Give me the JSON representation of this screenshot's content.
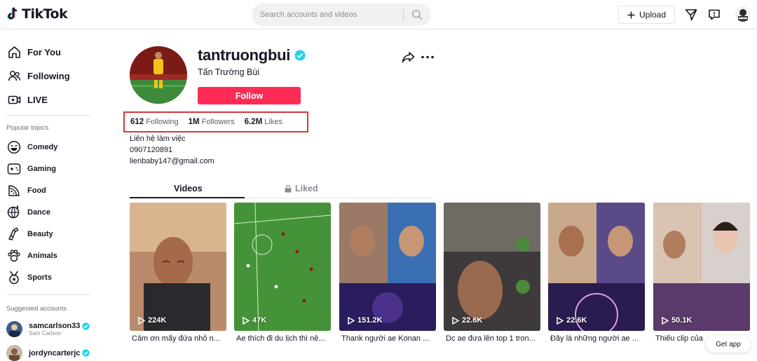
{
  "header": {
    "logo_text": "TikTok",
    "search_placeholder": "Search accounts and videos",
    "upload_label": "Upload",
    "icons": [
      "tiktok-logo-icon",
      "search-icon",
      "plus-icon",
      "send-icon",
      "inbox-icon",
      "avatar"
    ]
  },
  "sidebar": {
    "nav": [
      {
        "label": "For You",
        "icon": "home-icon"
      },
      {
        "label": "Following",
        "icon": "following-icon"
      },
      {
        "label": "LIVE",
        "icon": "live-icon"
      }
    ],
    "popular_title": "Popular topics",
    "topics": [
      {
        "label": "Comedy",
        "icon": "comedy-icon"
      },
      {
        "label": "Gaming",
        "icon": "gaming-icon"
      },
      {
        "label": "Food",
        "icon": "food-icon"
      },
      {
        "label": "Dance",
        "icon": "dance-icon"
      },
      {
        "label": "Beauty",
        "icon": "beauty-icon"
      },
      {
        "label": "Animals",
        "icon": "animals-icon"
      },
      {
        "label": "Sports",
        "icon": "sports-icon"
      }
    ],
    "suggested_title": "Suggested accounts",
    "suggested": [
      {
        "username": "samcarlson33",
        "name": "Sam Carlson"
      },
      {
        "username": "jordyncarterjc",
        "name": ""
      }
    ]
  },
  "profile": {
    "username": "tantruongbui",
    "display_name": "Tấn Trường Bùi",
    "follow_label": "Follow",
    "following_count": "612",
    "following_label": "Following",
    "followers_count": "1M",
    "followers_label": "Followers",
    "likes_count": "6.2M",
    "likes_label": "Likes",
    "bio": [
      "Liên hệ làm việc",
      "0907120891",
      "lienbaby147@gmail.com"
    ]
  },
  "tabs": {
    "videos": "Videos",
    "liked": "Liked"
  },
  "videos": [
    {
      "views": "224K",
      "caption": "Cảm ơn mấy đứa nhỏ n..."
    },
    {
      "views": "47K",
      "caption": "Ae thích đi du lịch thì nê..."
    },
    {
      "views": "151.2K",
      "caption": "Thank người ae Konan ..."
    },
    {
      "views": "22.6K",
      "caption": "Dc ae đưa lên top 1 tron..."
    },
    {
      "views": "22.6K",
      "caption": "Đây là những người ae ..."
    },
    {
      "views": "50.1K",
      "caption": "Thiếu clip của"
    }
  ],
  "get_app_label": "Get app",
  "colors": {
    "accent": "#fe2c55",
    "verified": "#20d5ec",
    "highlight_box": "#d9363e"
  }
}
